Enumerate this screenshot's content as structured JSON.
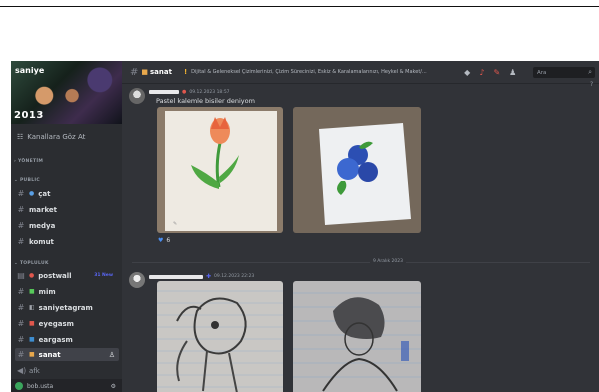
{
  "sidebar": {
    "server_name": "saniye",
    "banner_year": "2013",
    "browse_label": "Kanallara Göz At",
    "categories": {
      "yonetim": "YÖNETİM",
      "public": "PUBLIC",
      "topluluk": "TOPLULUK"
    },
    "channels_public": [
      {
        "label": "çat"
      },
      {
        "label": "market"
      },
      {
        "label": "medya"
      },
      {
        "label": "komut"
      }
    ],
    "channels_topluluk": [
      {
        "label": "postwall",
        "badge": "31 New"
      },
      {
        "label": "mim"
      },
      {
        "label": "saniyetagram"
      },
      {
        "label": "eyegasm"
      },
      {
        "label": "eargasm"
      },
      {
        "label": "sanat"
      }
    ],
    "voice": {
      "label": "afk"
    },
    "user": {
      "name": "bob.usta"
    }
  },
  "header": {
    "channel": "sanat",
    "topic": "Dijital & Geleneksel Çizimlerinizi, Çizim Sürecinizi, Eskiz & Karalamalarınızı, Heykel & Maket/...",
    "search_placeholder": "Ara"
  },
  "messages": [
    {
      "timestamp": "09.12.2023 18:57",
      "text": "Pastel kalemle bisiler deniyom",
      "reaction": {
        "emoji": "heart",
        "count": "6"
      }
    },
    {
      "timestamp": "09.12.2023 22:23"
    }
  ],
  "date_divider": "9 Aralık 2023",
  "colors": {
    "accent": "#5865f2",
    "sidebar_bg": "#2b2d31",
    "main_bg": "#313338"
  }
}
